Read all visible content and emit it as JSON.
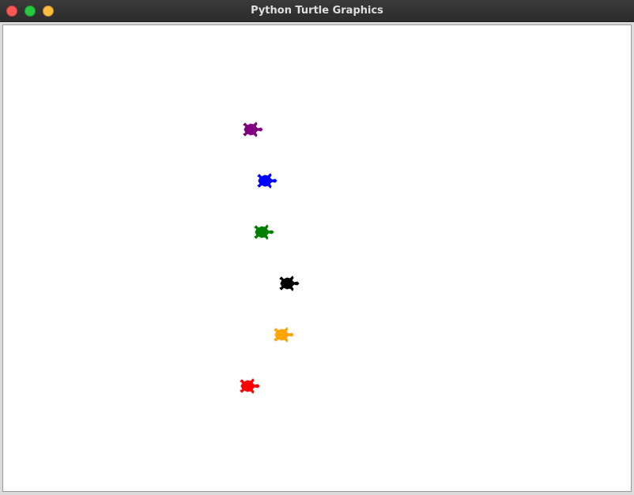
{
  "window": {
    "title": "Python Turtle Graphics",
    "buttons": [
      {
        "name": "close",
        "color": "#fc5753"
      },
      {
        "name": "maximize",
        "color": "#28c840"
      },
      {
        "name": "minimize",
        "color": "#fdbc40"
      }
    ]
  },
  "canvas": {
    "background": "#ffffff",
    "turtles": [
      {
        "color": "purple",
        "fill": "#800080"
      },
      {
        "color": "blue",
        "fill": "#0000ff"
      },
      {
        "color": "green",
        "fill": "#008000"
      },
      {
        "color": "black",
        "fill": "#000000"
      },
      {
        "color": "orange",
        "fill": "#ffa500"
      },
      {
        "color": "red",
        "fill": "#ff0000"
      }
    ]
  }
}
